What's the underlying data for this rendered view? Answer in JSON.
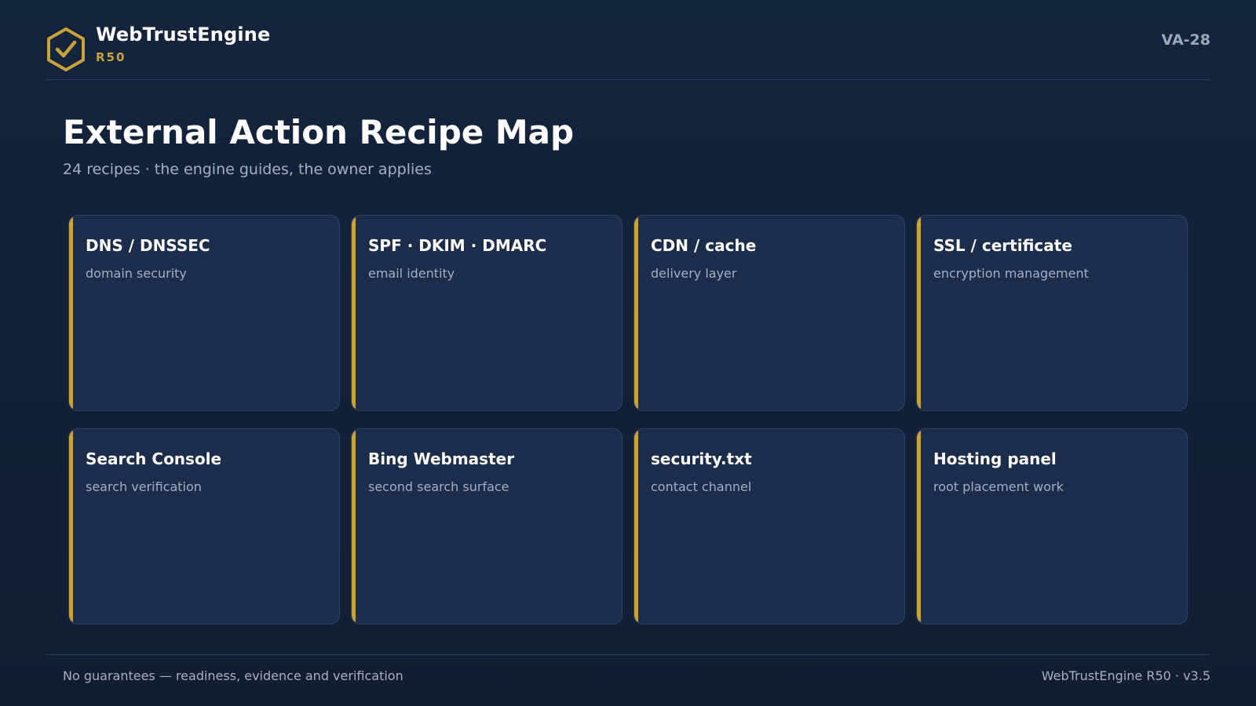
{
  "header": {
    "brand_name": "WebTrustEngine",
    "brand_sub": "R50",
    "code": "VA-28",
    "logo_icon": "hexagon-check-icon"
  },
  "page": {
    "title": "External Action Recipe Map",
    "subtitle": "24 recipes · the engine guides, the owner applies"
  },
  "cards": [
    {
      "title": "DNS / DNSSEC",
      "desc": "domain security"
    },
    {
      "title": "SPF · DKIM · DMARC",
      "desc": "email identity"
    },
    {
      "title": "CDN / cache",
      "desc": "delivery layer"
    },
    {
      "title": "SSL / certificate",
      "desc": "encryption management"
    },
    {
      "title": "Search Console",
      "desc": "search verification"
    },
    {
      "title": "Bing Webmaster",
      "desc": "second search surface"
    },
    {
      "title": "security.txt",
      "desc": "contact channel"
    },
    {
      "title": "Hosting panel",
      "desc": "root placement work"
    }
  ],
  "footer": {
    "left": "No guarantees — readiness, evidence and verification",
    "right": "WebTrustEngine R50 · v3.5"
  },
  "colors": {
    "background": "#13243d",
    "card": "#1b2d4a",
    "accent": "#c9a23a",
    "muted_text": "#a4b0c2"
  }
}
